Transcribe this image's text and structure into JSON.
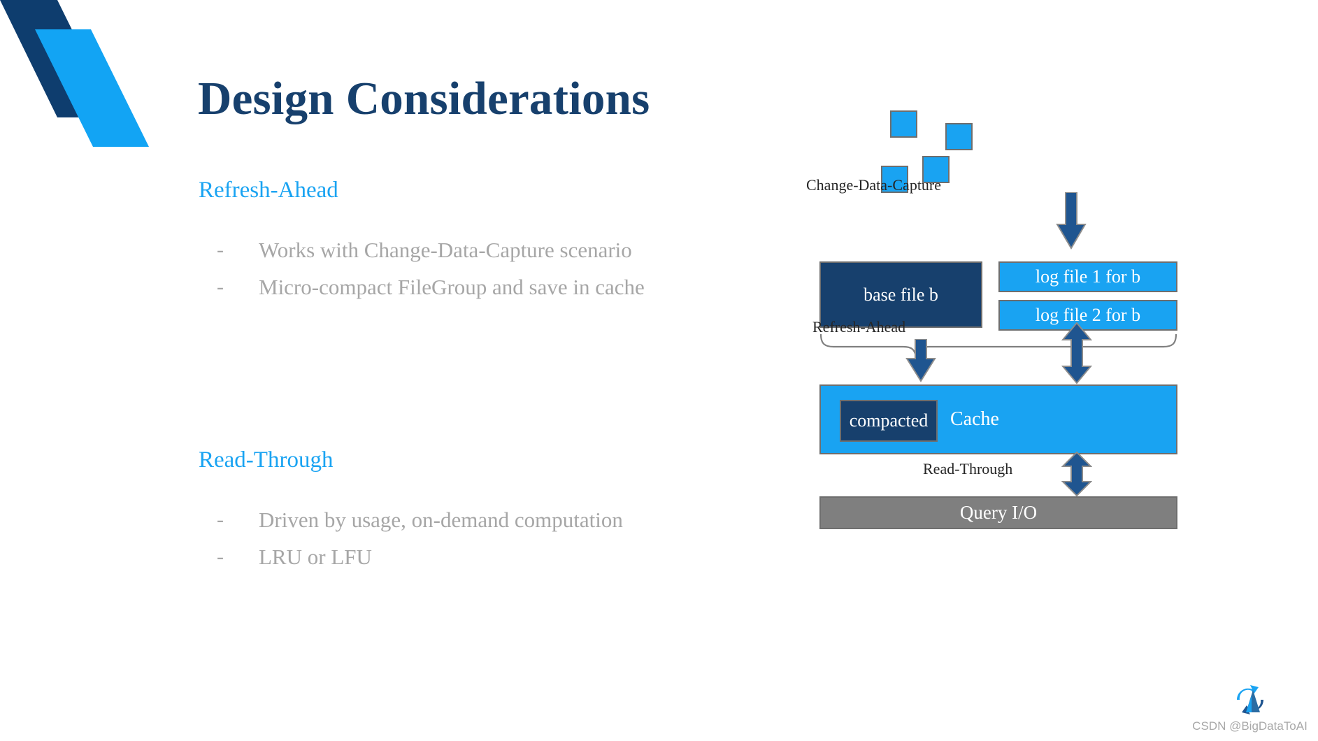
{
  "slide": {
    "title": "Design Considerations",
    "title_color": "#17406D",
    "background": "#ffffff"
  },
  "theme": {
    "accent_blue": "#19A3F2",
    "dark_navy": "#17406D",
    "arrow_blue": "#1F5590",
    "body_gray": "#A6A6A6",
    "box_border_gray": "#6E6E6E",
    "query_gray": "#7F7F7F"
  },
  "decoration": {
    "corner_shape_name": "angled-ribbon",
    "dark_color": "#0E3D6E",
    "light_color": "#12A4F4"
  },
  "sections": [
    {
      "heading": "Refresh-Ahead",
      "bullets": [
        {
          "marker": "-",
          "text": "Works with Change-Data-Capture scenario"
        },
        {
          "marker": "-",
          "text": "Micro-compact FileGroup and save in cache"
        }
      ]
    },
    {
      "heading": "Read-Through",
      "bullets": [
        {
          "marker": "-",
          "text": "Driven by usage, on-demand computation"
        },
        {
          "marker": "-",
          "text": "LRU or LFU"
        }
      ]
    }
  ],
  "diagram": {
    "incoming_squares": [
      {
        "id": "square-1"
      },
      {
        "id": "square-2"
      },
      {
        "id": "square-3"
      },
      {
        "id": "square-4"
      }
    ],
    "labels": {
      "change_data_capture": "Change-Data-Capture",
      "refresh_ahead": "Refresh-Ahead",
      "read_through": "Read-Through"
    },
    "boxes": {
      "base_file": "base file b",
      "log_file_1": "log file 1 for b",
      "log_file_2": "log file 2 for b",
      "compacted": "compacted",
      "cache": "Cache",
      "query_io": "Query I/O"
    },
    "arrows": [
      {
        "name": "cdc-down-arrow",
        "direction": "down"
      },
      {
        "name": "refresh-ahead-down-arrow",
        "direction": "down"
      },
      {
        "name": "cache-log-double-arrow",
        "direction": "up-down"
      },
      {
        "name": "read-through-double-arrow",
        "direction": "up-down"
      }
    ],
    "brace": {
      "name": "refresh-ahead-brace",
      "color": "#808080"
    }
  },
  "watermark": {
    "text": "CSDN @BigDataToAI",
    "logo_name": "bigdatatoai-logo"
  }
}
